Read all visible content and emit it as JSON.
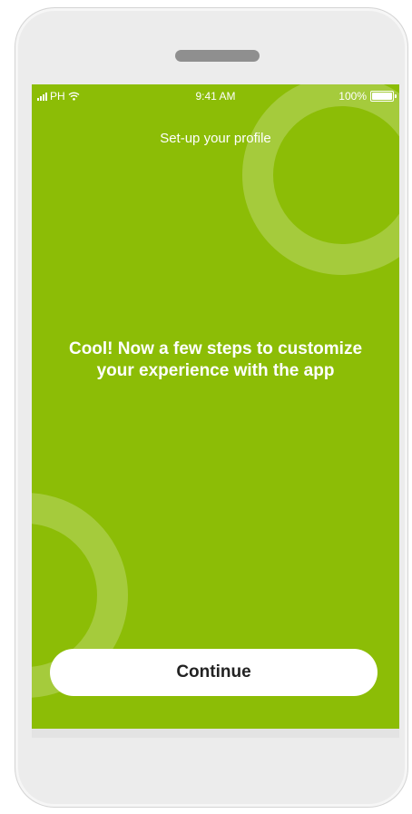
{
  "status_bar": {
    "carrier": "PH",
    "time": "9:41 AM",
    "battery_percent_label": "100%",
    "battery_level": 1.0
  },
  "screen": {
    "title": "Set-up your profile",
    "headline": "Cool! Now a few steps to customize your experience with the app",
    "continue_label": "Continue"
  },
  "colors": {
    "background_green": "#8cbd06",
    "text_white": "#ffffff",
    "button_bg": "#ffffff",
    "button_text": "#222222"
  }
}
